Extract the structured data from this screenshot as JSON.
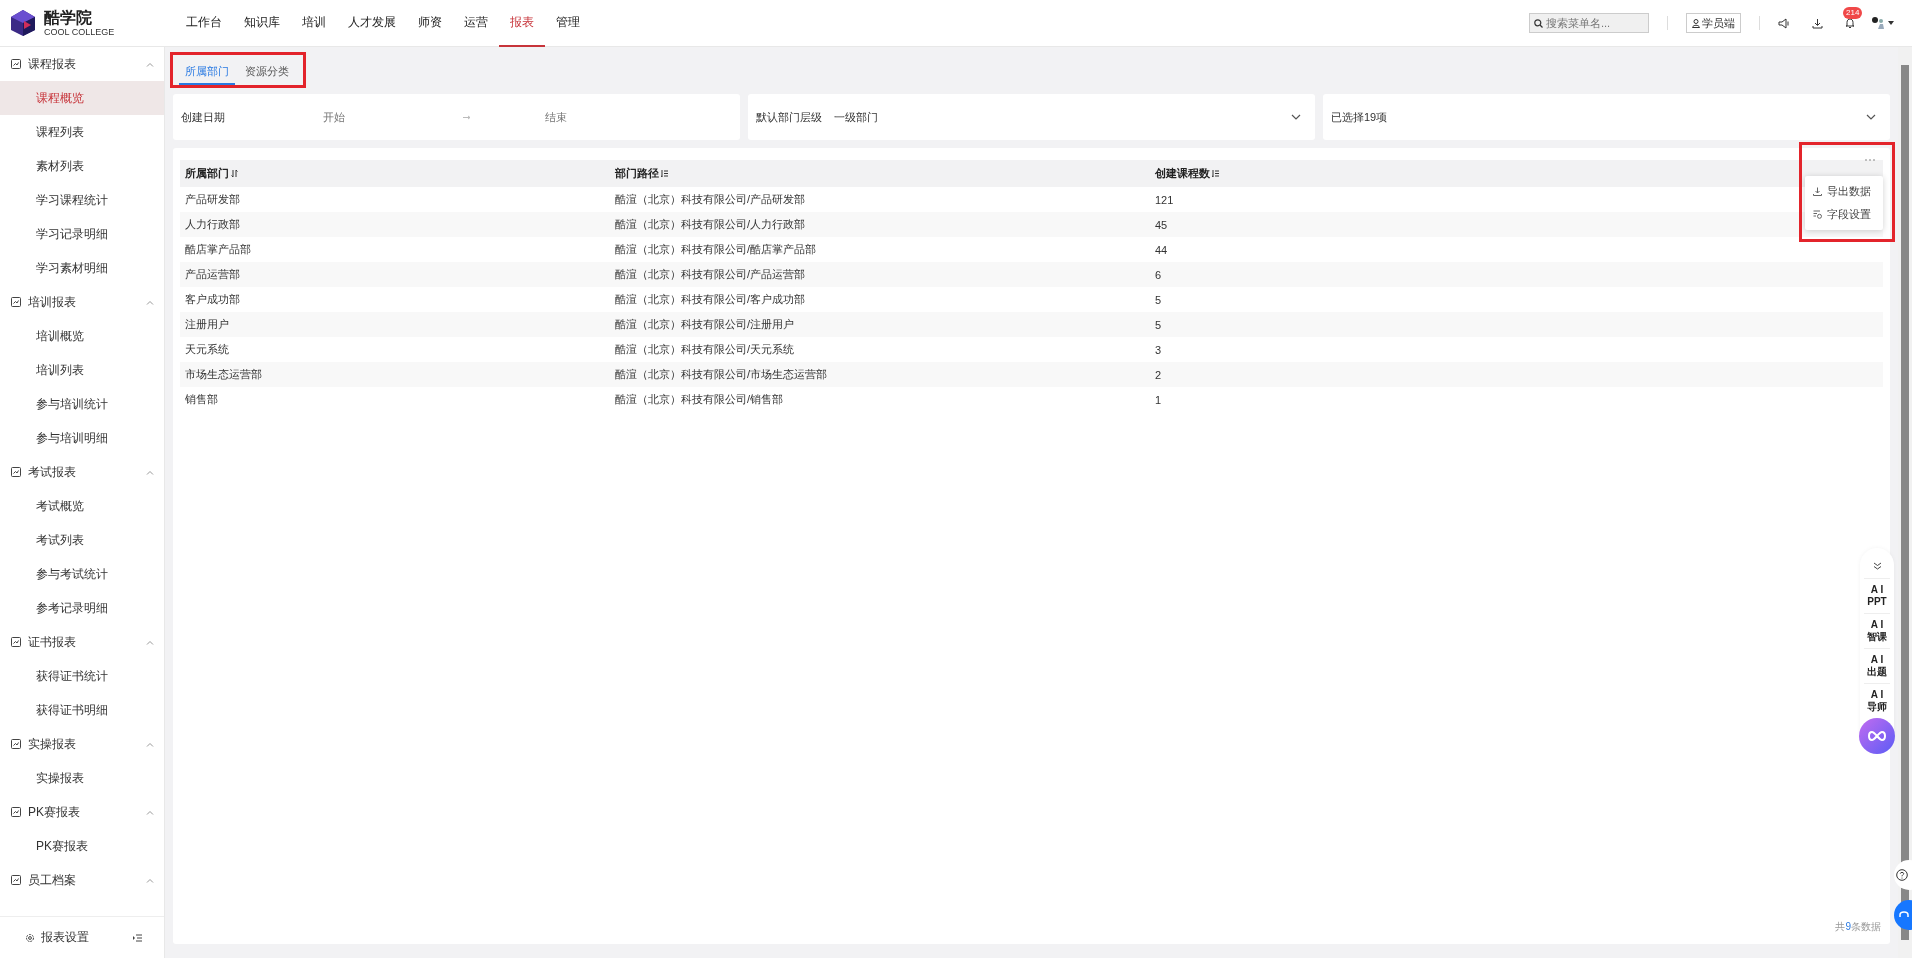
{
  "header": {
    "logo": {
      "name": "酷学院",
      "subtitle": "COOL COLLEGE"
    },
    "nav": [
      {
        "label": "工作台",
        "selected": false
      },
      {
        "label": "知识库",
        "selected": false
      },
      {
        "label": "培训",
        "selected": false
      },
      {
        "label": "人才发展",
        "selected": false
      },
      {
        "label": "师资",
        "selected": false
      },
      {
        "label": "运营",
        "selected": false
      },
      {
        "label": "报表",
        "selected": true
      },
      {
        "label": "管理",
        "selected": false
      }
    ],
    "search": {
      "placeholder": "搜索菜单名..."
    },
    "student_button": "学员端",
    "notification_count": "214"
  },
  "sidebar": {
    "groups": [
      {
        "label": "课程报表",
        "expanded": true,
        "items": [
          {
            "label": "课程概览",
            "selected": true
          },
          {
            "label": "课程列表",
            "selected": false
          },
          {
            "label": "素材列表",
            "selected": false
          },
          {
            "label": "学习课程统计",
            "selected": false
          },
          {
            "label": "学习记录明细",
            "selected": false
          },
          {
            "label": "学习素材明细",
            "selected": false
          }
        ]
      },
      {
        "label": "培训报表",
        "expanded": true,
        "items": [
          {
            "label": "培训概览",
            "selected": false
          },
          {
            "label": "培训列表",
            "selected": false
          },
          {
            "label": "参与培训统计",
            "selected": false
          },
          {
            "label": "参与培训明细",
            "selected": false
          }
        ]
      },
      {
        "label": "考试报表",
        "expanded": true,
        "items": [
          {
            "label": "考试概览",
            "selected": false
          },
          {
            "label": "考试列表",
            "selected": false
          },
          {
            "label": "参与考试统计",
            "selected": false
          },
          {
            "label": "参考记录明细",
            "selected": false
          }
        ]
      },
      {
        "label": "证书报表",
        "expanded": true,
        "items": [
          {
            "label": "获得证书统计",
            "selected": false
          },
          {
            "label": "获得证书明细",
            "selected": false
          }
        ]
      },
      {
        "label": "实操报表",
        "expanded": true,
        "items": [
          {
            "label": "实操报表",
            "selected": false
          }
        ]
      },
      {
        "label": "PK赛报表",
        "expanded": true,
        "items": [
          {
            "label": "PK赛报表",
            "selected": false
          }
        ]
      },
      {
        "label": "员工档案",
        "expanded": true
      }
    ],
    "footer": "报表设置"
  },
  "tabs": [
    {
      "label": "所属部门",
      "selected": true
    },
    {
      "label": "资源分类",
      "selected": false
    }
  ],
  "filters": {
    "date": {
      "label": "创建日期",
      "start_placeholder": "开始",
      "end_placeholder": "结束"
    },
    "level": {
      "label": "默认部门层级",
      "value": "一级部门"
    },
    "selection": {
      "value": "已选择19项"
    }
  },
  "table": {
    "columns": [
      "所属部门",
      "部门路径",
      "创建课程数"
    ],
    "rows": [
      [
        "产品研发部",
        "酷渲（北京）科技有限公司/产品研发部",
        "121"
      ],
      [
        "人力行政部",
        "酷渲（北京）科技有限公司/人力行政部",
        "45"
      ],
      [
        "酷店掌产品部",
        "酷渲（北京）科技有限公司/酷店掌产品部",
        "44"
      ],
      [
        "产品运营部",
        "酷渲（北京）科技有限公司/产品运营部",
        "6"
      ],
      [
        "客户成功部",
        "酷渲（北京）科技有限公司/客户成功部",
        "5"
      ],
      [
        "注册用户",
        "酷渲（北京）科技有限公司/注册用户",
        "5"
      ],
      [
        "天元系统",
        "酷渲（北京）科技有限公司/天元系统",
        "3"
      ],
      [
        "市场生态运营部",
        "酷渲（北京）科技有限公司/市场生态运营部",
        "2"
      ],
      [
        "销售部",
        "酷渲（北京）科技有限公司/销售部",
        "1"
      ]
    ],
    "menu": {
      "items": [
        "导出数据",
        "字段设置"
      ]
    },
    "total": {
      "prefix": "共",
      "count": "9",
      "suffix": "条数据"
    }
  },
  "ai_tools": [
    {
      "top": "A I",
      "bottom": "PPT"
    },
    {
      "top": "A I",
      "bottom": "智课"
    },
    {
      "top": "A I",
      "bottom": "出题"
    },
    {
      "top": "A I",
      "bottom": "导师"
    }
  ]
}
